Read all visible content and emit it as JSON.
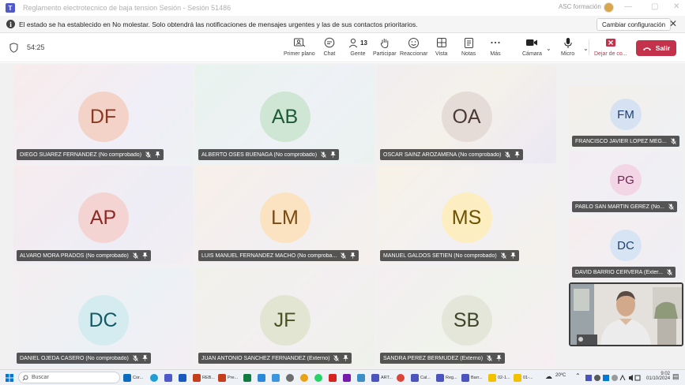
{
  "window": {
    "title": "Reglamento electrotecnico de baja tension Sesión - Sesión 51486",
    "org": "ASC formación",
    "controls": [
      "—",
      "▢",
      "✕"
    ]
  },
  "notification": {
    "message": "El estado se ha establecido en No molestar. Solo obtendrá las notificaciones de mensajes urgentes y las de sus contactos prioritarios.",
    "settings_button": "Cambiar configuración"
  },
  "toolbar": {
    "timer": "54:25",
    "buttons": [
      {
        "label": "Primer plano",
        "icon": "spotlight-icon"
      },
      {
        "label": "Chat",
        "icon": "chat-icon"
      },
      {
        "label": "Gente",
        "icon": "people-icon",
        "count": "13"
      },
      {
        "label": "Participar",
        "icon": "raise-hand-icon"
      },
      {
        "label": "Reaccionar",
        "icon": "react-icon"
      },
      {
        "label": "Vista",
        "icon": "grid-view-icon"
      },
      {
        "label": "Notas",
        "icon": "notes-icon"
      },
      {
        "label": "Más",
        "icon": "more-icon"
      },
      {
        "label": "Cámara",
        "icon": "camera-icon"
      },
      {
        "label": "Micro",
        "icon": "microphone-icon"
      },
      {
        "label": "Dejar de co...",
        "icon": "stop-share-icon"
      }
    ],
    "leave_button": "Salir",
    "colors": {
      "leave": "#c4314b"
    }
  },
  "grid": [
    {
      "initials": "DF",
      "name": "DIEGO SUAREZ FERNANDEZ (No comprobado)",
      "avatar_bg": "#f3d3c8",
      "avatar_fg": "#8a3a22"
    },
    {
      "initials": "AB",
      "name": "ALBERTO OSES BUENAGA (No comprobado)",
      "avatar_bg": "#cfe6d5",
      "avatar_fg": "#1d5a35"
    },
    {
      "initials": "OA",
      "name": "OSCAR SAINZ AROZAMENA (No comprobado)",
      "avatar_bg": "#e5dcd7",
      "avatar_fg": "#4a3a33"
    },
    {
      "initials": "AP",
      "name": "ALVARO MORA PRADOS (No comprobado)",
      "avatar_bg": "#f4d4d2",
      "avatar_fg": "#8e2a26"
    },
    {
      "initials": "LM",
      "name": "LUIS MANUEL FERNANDEZ MACHO (No comproba...",
      "avatar_bg": "#fbe3c2",
      "avatar_fg": "#7a4a10"
    },
    {
      "initials": "MS",
      "name": "MANUEL GALDOS SETIEN (No comprobado)",
      "avatar_bg": "#fdeec2",
      "avatar_fg": "#6b5300"
    },
    {
      "initials": "DC",
      "name": "DANIEL OJEDA CASERO (No comprobado)",
      "avatar_bg": "#d4ecef",
      "avatar_fg": "#145a66"
    },
    {
      "initials": "JF",
      "name": "JUAN ANTONIO SANCHEZ FERNANDEZ (Externo)",
      "avatar_bg": "#e2e5d2",
      "avatar_fg": "#4b5222"
    },
    {
      "initials": "SB",
      "name": "SANDRA PEREZ BERMUDEZ (Externo)",
      "avatar_bg": "#e3e6d8",
      "avatar_fg": "#3e4528"
    }
  ],
  "side": [
    {
      "initials": "FM",
      "name": "FRANCISCO JAVIER LOPEZ MEG...",
      "avatar_bg": "#d6e2f2",
      "avatar_fg": "#1f3f6e"
    },
    {
      "initials": "PG",
      "name": "PABLO SAN MARTIN GEREZ (No...",
      "avatar_bg": "#f3d6e6",
      "avatar_fg": "#6e2350"
    },
    {
      "initials": "DC",
      "name": "DAVID BARRIO CERVERA (Exter...",
      "avatar_bg": "#d6e4f3",
      "avatar_fg": "#1f416e"
    }
  ],
  "taskbar": {
    "search_placeholder": "Buscar",
    "apps": [
      {
        "label": "Cor...",
        "color": "#0f6cbd"
      },
      {
        "label": "REB...",
        "color": "#c43e1c"
      },
      {
        "label": "Pre...",
        "color": "#c43e1c"
      },
      {
        "label": "ART...",
        "color": "#4b53bc"
      },
      {
        "label": "Cal...",
        "color": "#4b53bc"
      },
      {
        "label": "Reg...",
        "color": "#4b53bc"
      },
      {
        "label": "Barr...",
        "color": "#4b53bc"
      },
      {
        "label": "02-1...",
        "color": "#f2c200"
      },
      {
        "label": "01-...",
        "color": "#f2c200"
      }
    ],
    "weather": "20ºC",
    "time": "9:02",
    "date": "01/10/2024"
  }
}
